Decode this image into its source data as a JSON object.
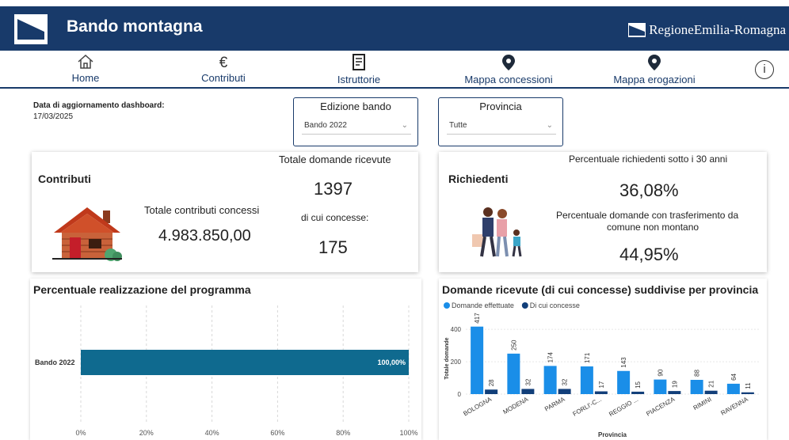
{
  "header": {
    "title": "Bando montagna",
    "brand": "RegioneEmilia-Romagna"
  },
  "nav": {
    "items": [
      {
        "label": "Home",
        "icon": "home-icon"
      },
      {
        "label": "Contributi",
        "icon": "euro-icon"
      },
      {
        "label": "Istruttorie",
        "icon": "document-icon"
      },
      {
        "label": "Mappa concessioni",
        "icon": "map-pin-icon"
      },
      {
        "label": "Mappa erogazioni",
        "icon": "map-pin-icon"
      }
    ],
    "info_symbol": "i"
  },
  "update": {
    "label": "Data di aggiornamento dashboard:",
    "date": "17/03/2025"
  },
  "filters": {
    "edizione": {
      "title": "Edizione bando",
      "value": "Bando 2022"
    },
    "provincia": {
      "title": "Provincia",
      "value": "Tutte"
    }
  },
  "contributi": {
    "title": "Contributi",
    "totale_domande_label": "Totale domande ricevute",
    "totale_domande": "1397",
    "concesse_label": "di cui concesse:",
    "concesse": "175",
    "contributi_label": "Totale contributi concessi",
    "contributi_value": "4.983.850,00"
  },
  "richiedenti": {
    "title": "Richiedenti",
    "under30_label": "Percentuale richiedenti sotto i 30 anni",
    "under30_value": "36,08%",
    "trasf_label_line1": "Percentuale domande con trasferimento da",
    "trasf_label_line2": "comune non montano",
    "trasf_value": "44,95%"
  },
  "colors": {
    "header": "#183a6a",
    "bar_program": "#0f6a8f",
    "series_effettuate": "#1a8ee8",
    "series_concesse": "#123f7a"
  },
  "chart_data": [
    {
      "type": "bar",
      "orientation": "horizontal",
      "title": "Percentuale realizzazione del programma",
      "categories": [
        "Bando 2022"
      ],
      "values": [
        100.0
      ],
      "value_labels": [
        "100,00%"
      ],
      "xlim": [
        0,
        100
      ],
      "xticks": [
        "0%",
        "20%",
        "40%",
        "60%",
        "80%",
        "100%"
      ],
      "grid": "vertical-dashed"
    },
    {
      "type": "bar",
      "title": "Domande ricevute (di cui concesse) suddivise per provincia",
      "xlabel": "Provincia",
      "ylabel": "Totale domande",
      "categories": [
        "BOLOGNA",
        "MODENA",
        "PARMA",
        "FORLI'-C...",
        "REGGIO ...",
        "PIACENZA",
        "RIMINI",
        "RAVENNA"
      ],
      "series": [
        {
          "name": "Domande effettuate",
          "values": [
            417,
            250,
            174,
            171,
            143,
            90,
            88,
            64
          ]
        },
        {
          "name": "Di cui concesse",
          "values": [
            28,
            32,
            32,
            17,
            15,
            19,
            21,
            11
          ]
        }
      ],
      "yticks": [
        "0",
        "200",
        "400"
      ],
      "ylim": [
        0,
        440
      ],
      "legend": "top-left"
    }
  ]
}
